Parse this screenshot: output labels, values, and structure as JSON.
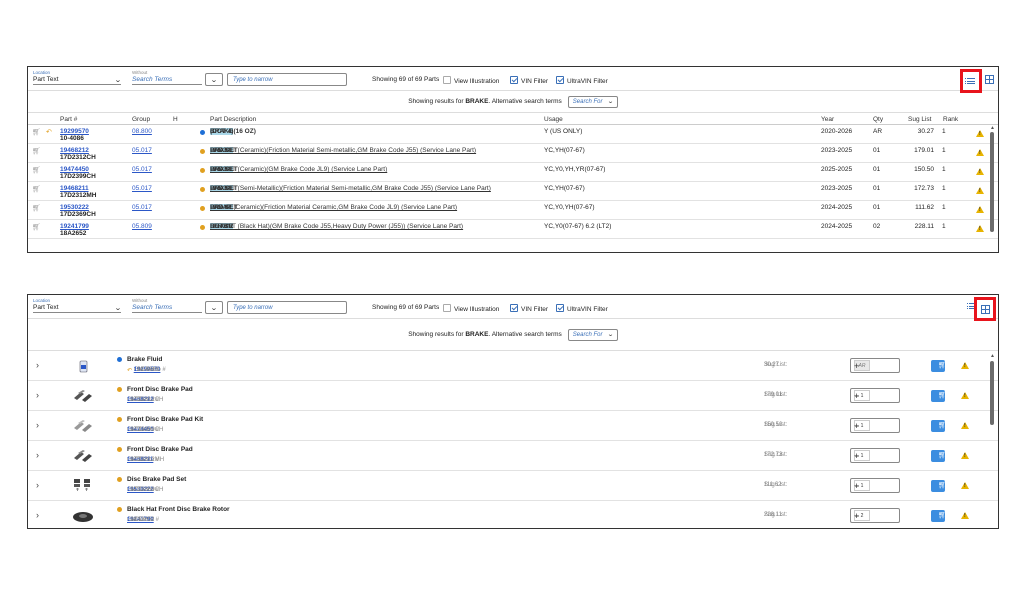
{
  "toolbar": {
    "location_label": "Location",
    "location_value": "Part Text",
    "without_label": "Without",
    "without_placeholder": "Search Terms",
    "narrow_placeholder": "Type to narrow",
    "showing_parts": "Showing 69 of 69 Parts",
    "view_illustration": "View Illustration",
    "vin_filter": "VIN Filter",
    "ultravin_filter": "UltraVIN Filter"
  },
  "results": {
    "prefix": "Showing results for",
    "term": "BRAKE",
    "suffix": ". Alternative search terms",
    "alt_placeholder": "Search For"
  },
  "table": {
    "headers": {
      "part": "Part #",
      "group": "Group",
      "h": "H",
      "desc": "Part Description",
      "usage": "Usage",
      "year": "Year",
      "qty": "Qty",
      "sug": "Sug List",
      "rank": "Rank"
    },
    "rows": [
      {
        "part": "19299570",
        "alt": "10-4086",
        "group": "08.800",
        "dot": "#1f6fd6",
        "desc_a": "FLUID, ",
        "desc_hl": "BRAKE",
        "desc_b": " (DOT 4)(16 OZ)",
        "usage": "Y (US ONLY)",
        "year": "2020-2026",
        "qty": "AR",
        "sug": "30.27",
        "rank": "1"
      },
      {
        "part": "19468212",
        "alt": "17D2312CH",
        "group": "05.017",
        "dot": "#e0a020",
        "desc_a": "DISC ",
        "desc_hl": "BRAKE",
        "desc_b": " PAD SET",
        "desc_c": ", FRONT (Ceramic)(Friction Material Semi-metallic,GM Brake Code J55) (Service Lane Part)",
        "usage": "YC,YH(07-67)",
        "year": "2023-2025",
        "qty": "01",
        "sug": "179.01",
        "rank": "1"
      },
      {
        "part": "19474450",
        "alt": "17D2399CH",
        "group": "05.017",
        "dot": "#e0a020",
        "desc_a": "DISC ",
        "desc_hl": "BRAKE",
        "desc_b": " PAD SET",
        "desc_c": ", FRONT (Ceramic)(GM Brake Code JL9) (Service Lane Part)",
        "usage": "YC,Y0,YH,YR(07-67)",
        "year": "2025-2025",
        "qty": "01",
        "sug": "150.50",
        "rank": "1"
      },
      {
        "part": "19468211",
        "alt": "17D2312MH",
        "group": "05.017",
        "dot": "#e0a020",
        "desc_a": "DISC ",
        "desc_hl": "BRAKE",
        "desc_b": " PAD SET",
        "desc_c": ", FRONT (Semi-Metallic)(Friction Material Semi-metallic,GM Brake Code J55) (Service Lane Part)",
        "usage": "YC,YH(07-67)",
        "year": "2023-2025",
        "qty": "01",
        "sug": "172.73",
        "rank": "1"
      },
      {
        "part": "19530222",
        "alt": "17D2369CH",
        "group": "05.017",
        "dot": "#e0a020",
        "desc_a": "DISC ",
        "desc_hl": "BRAKE",
        "desc_b": " PAD SET",
        "desc_c": ", REAR (Ceramic)(Friction Material Ceramic,GM Brake Code JL9) (Service Lane Part)",
        "usage": "YC,Y0,YH(07-67)",
        "year": "2024-2025",
        "qty": "01",
        "sug": "111.62",
        "rank": "1"
      },
      {
        "part": "19241799",
        "alt": "18A2652",
        "group": "05.809",
        "dot": "#e0a020",
        "desc_a": "DISC ",
        "desc_hl": "BRAKE",
        "desc_b": " ROTOR",
        "desc_c": ", FRONT (Black Hat)(GM Brake Code J55,Heavy Duty Power (J55)) (Service Lane Part)",
        "usage": "YC,Y0(07-67) 6.2 (LT2)",
        "year": "2024-2025",
        "qty": "02",
        "sug": "228.11",
        "rank": "1"
      }
    ]
  },
  "cards": {
    "gm_label": "GM #",
    "acdelco_label": "ACDelco #",
    "sug_label": "Sug List:",
    "items": [
      {
        "name": "Brake Fluid",
        "gm": "19299570",
        "acdelco": "10-4086",
        "sug": "30.27",
        "qty": "AR",
        "dot": "#1f6fd6"
      },
      {
        "name": "Front Disc Brake Pad",
        "gm": "19468212",
        "acdelco": "17D2312CH",
        "sug": "179.01",
        "qty": "1",
        "dot": "#e0a020"
      },
      {
        "name": "Front Disc Brake Pad Kit",
        "gm": "19474450",
        "acdelco": "17D2399CH",
        "sug": "150.50",
        "qty": "1",
        "dot": "#e0a020"
      },
      {
        "name": "Front Disc Brake Pad",
        "gm": "19468211",
        "acdelco": "17D2312MH",
        "sug": "172.73",
        "qty": "1",
        "dot": "#e0a020"
      },
      {
        "name": "Disc Brake Pad Set",
        "gm": "19530222",
        "acdelco": "17D2369CH",
        "sug": "111.62",
        "qty": "1",
        "dot": "#e0a020"
      },
      {
        "name": "Black Hat Front Disc Brake Rotor",
        "gm": "19241799",
        "acdelco": "18A2652",
        "sug": "228.11",
        "qty": "2",
        "dot": "#e0a020"
      }
    ]
  },
  "colors": {
    "accent": "#3a6fb7",
    "highlight_box": "#e8141c",
    "warning": "#e8b400"
  }
}
